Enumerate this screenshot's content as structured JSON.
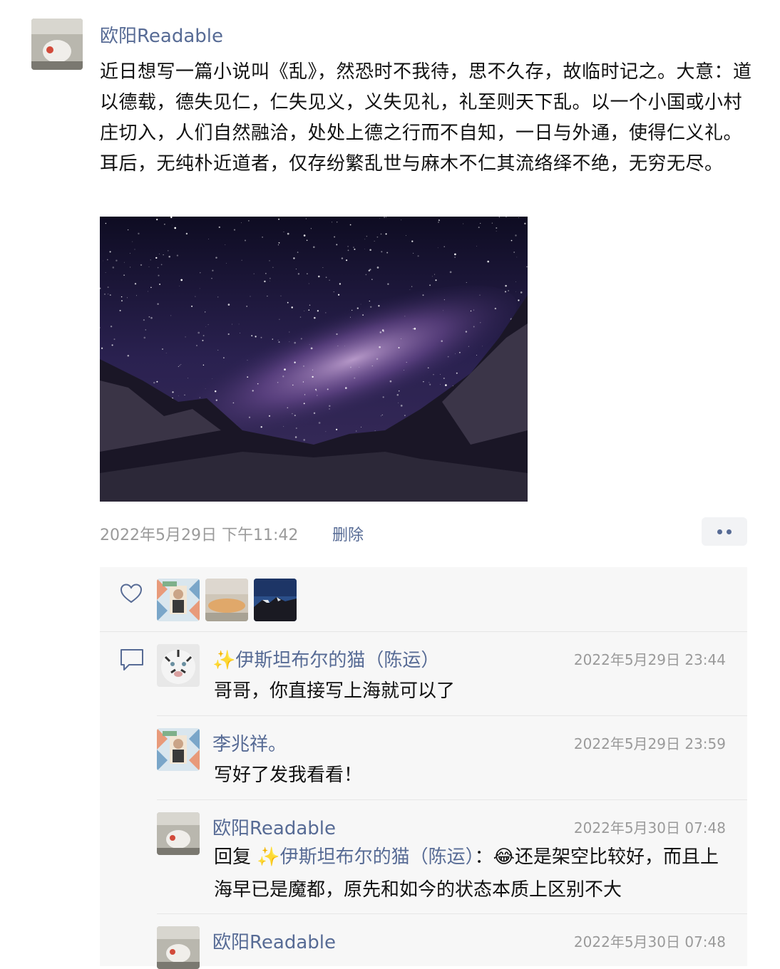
{
  "post": {
    "author": "欧阳Readable",
    "text": "近日想写一篇小说叫《乱》，然恐时不我待，思不久存，故临时记之。大意：道以德载，德失见仁，仁失见义，义失见礼，礼至则天下乱。以一个小国或小村庄切入，人们自然融洽，处处上德之行而不自知，一日与外通，使得仁义礼。耳后，无纯朴近道者，仅存纷繁乱世与麻木不仁其流络绎不绝，无穷无尽。",
    "time": "2022年5月29日 下午11:42",
    "delete_label": "删除"
  },
  "likes": {
    "count": 3
  },
  "comments": [
    {
      "name": "✨伊斯坦布尔的猫（陈运）",
      "time": "2022年5月29日 23:44",
      "text": "哥哥，你直接写上海就可以了"
    },
    {
      "name": "李兆祥。",
      "time": "2022年5月29日 23:59",
      "text": "写好了发我看看！"
    },
    {
      "name": "欧阳Readable",
      "time": "2022年5月30日 07:48",
      "reply_prefix": "回复 ",
      "reply_to": "✨伊斯坦布尔的猫（陈运）",
      "reply_colon": "：",
      "emoji": "😂",
      "text": "还是架空比较好，而且上海早已是魔都，原先和如今的状态本质上区别不大"
    },
    {
      "name": "欧阳Readable",
      "time": "2022年5月30日 07:48",
      "text": ""
    }
  ]
}
